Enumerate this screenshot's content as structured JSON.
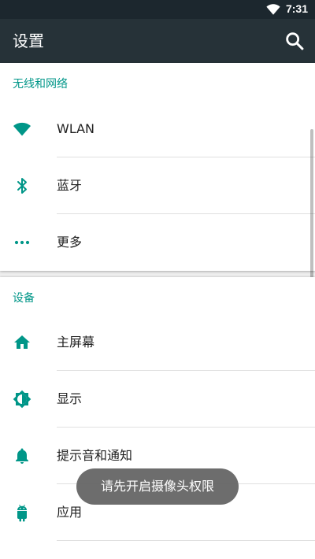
{
  "status_bar": {
    "time": "7:31",
    "icons": [
      "wifi-icon"
    ]
  },
  "app_bar": {
    "title": "设置",
    "action_icon": "search-icon"
  },
  "sections": [
    {
      "title": "无线和网络",
      "items": [
        {
          "label": "WLAN",
          "icon": "wifi-icon"
        },
        {
          "label": "蓝牙",
          "icon": "bluetooth-icon"
        },
        {
          "label": "更多",
          "icon": "more-horiz-icon"
        }
      ]
    },
    {
      "title": "设备",
      "items": [
        {
          "label": "主屏幕",
          "icon": "home-icon"
        },
        {
          "label": "显示",
          "icon": "brightness-icon"
        },
        {
          "label": "提示音和通知",
          "icon": "bell-icon"
        },
        {
          "label": "应用",
          "icon": "android-icon"
        }
      ]
    }
  ],
  "toast": {
    "message": "请先开启摄像头权限"
  },
  "colors": {
    "accent": "#009688",
    "app_bar": "#263238",
    "status_bar": "#1c272e"
  }
}
